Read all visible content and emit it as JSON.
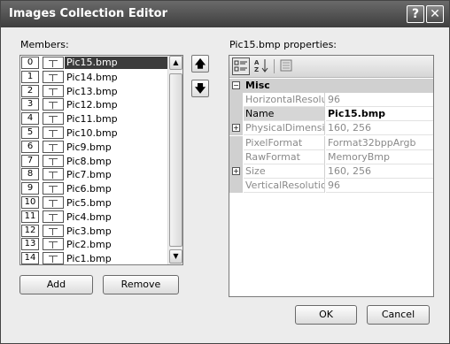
{
  "window": {
    "title": "Images Collection Editor",
    "help_glyph": "?",
    "close_glyph": "✕"
  },
  "members": {
    "label": "Members:",
    "items": [
      {
        "index": "0",
        "name": "Pic15.bmp"
      },
      {
        "index": "1",
        "name": "Pic14.bmp"
      },
      {
        "index": "2",
        "name": "Pic13.bmp"
      },
      {
        "index": "3",
        "name": "Pic12.bmp"
      },
      {
        "index": "4",
        "name": "Pic11.bmp"
      },
      {
        "index": "5",
        "name": "Pic10.bmp"
      },
      {
        "index": "6",
        "name": "Pic9.bmp"
      },
      {
        "index": "7",
        "name": "Pic8.bmp"
      },
      {
        "index": "8",
        "name": "Pic7.bmp"
      },
      {
        "index": "9",
        "name": "Pic6.bmp"
      },
      {
        "index": "10",
        "name": "Pic5.bmp"
      },
      {
        "index": "11",
        "name": "Pic4.bmp"
      },
      {
        "index": "12",
        "name": "Pic3.bmp"
      },
      {
        "index": "13",
        "name": "Pic2.bmp"
      },
      {
        "index": "14",
        "name": "Pic1.bmp"
      }
    ],
    "selected_index": 0,
    "add_label": "Add",
    "remove_label": "Remove",
    "move_up_glyph": "🡅",
    "move_down_glyph": "🡇"
  },
  "properties": {
    "label": "Pic15.bmp properties:",
    "category": "Misc",
    "category_toggle": "−",
    "rows": [
      {
        "name": "HorizontalResolution",
        "value": "96",
        "expandable": false,
        "active": false
      },
      {
        "name": "Name",
        "value": "Pic15.bmp",
        "expandable": false,
        "active": true
      },
      {
        "name": "PhysicalDimension",
        "value": "160, 256",
        "expandable": true,
        "active": false
      },
      {
        "name": "PixelFormat",
        "value": "Format32bppArgb",
        "expandable": false,
        "active": false
      },
      {
        "name": "RawFormat",
        "value": "MemoryBmp",
        "expandable": false,
        "active": false
      },
      {
        "name": "Size",
        "value": "160, 256",
        "expandable": true,
        "active": false
      },
      {
        "name": "VerticalResolution",
        "value": "96",
        "expandable": false,
        "active": false
      }
    ],
    "expand_glyph": "+",
    "toolbar": {
      "categorized_icon": "categorized-icon",
      "alphabetical_icon": "alphabetical-icon",
      "property_pages_icon": "property-pages-icon"
    }
  },
  "footer": {
    "ok_label": "OK",
    "cancel_label": "Cancel"
  }
}
